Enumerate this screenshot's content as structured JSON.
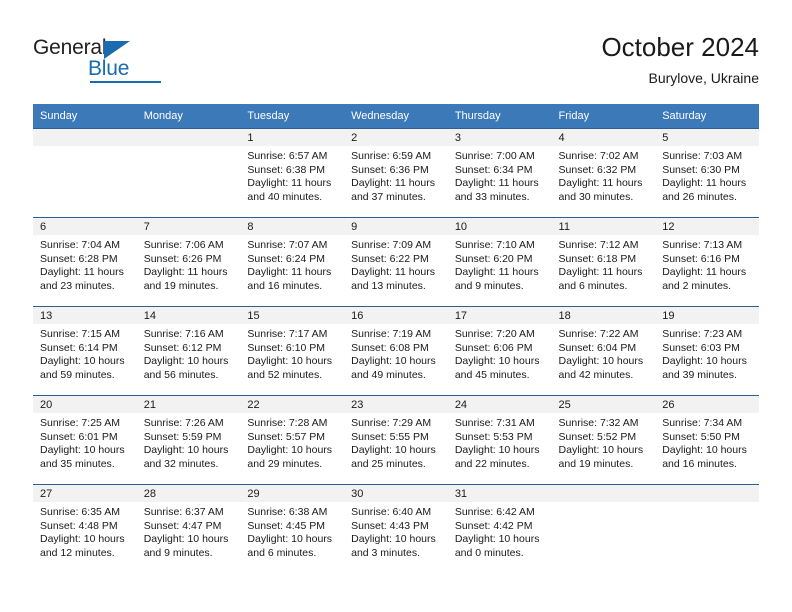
{
  "brand": {
    "word1": "General",
    "word2": "Blue",
    "triangle_color": "#1a6cb0"
  },
  "header": {
    "title": "October 2024",
    "subtitle": "Burylove, Ukraine",
    "accent_color": "#3b79b8",
    "grid_line_color": "#2e5f94",
    "daynum_strip_color": "#f2f2f2"
  },
  "weekday_headers": [
    "Sunday",
    "Monday",
    "Tuesday",
    "Wednesday",
    "Thursday",
    "Friday",
    "Saturday"
  ],
  "weeks": [
    [
      {
        "day": "",
        "lines": []
      },
      {
        "day": "",
        "lines": []
      },
      {
        "day": "1",
        "lines": [
          "Sunrise: 6:57 AM",
          "Sunset: 6:38 PM",
          "Daylight: 11 hours",
          "and 40 minutes."
        ]
      },
      {
        "day": "2",
        "lines": [
          "Sunrise: 6:59 AM",
          "Sunset: 6:36 PM",
          "Daylight: 11 hours",
          "and 37 minutes."
        ]
      },
      {
        "day": "3",
        "lines": [
          "Sunrise: 7:00 AM",
          "Sunset: 6:34 PM",
          "Daylight: 11 hours",
          "and 33 minutes."
        ]
      },
      {
        "day": "4",
        "lines": [
          "Sunrise: 7:02 AM",
          "Sunset: 6:32 PM",
          "Daylight: 11 hours",
          "and 30 minutes."
        ]
      },
      {
        "day": "5",
        "lines": [
          "Sunrise: 7:03 AM",
          "Sunset: 6:30 PM",
          "Daylight: 11 hours",
          "and 26 minutes."
        ]
      }
    ],
    [
      {
        "day": "6",
        "lines": [
          "Sunrise: 7:04 AM",
          "Sunset: 6:28 PM",
          "Daylight: 11 hours",
          "and 23 minutes."
        ]
      },
      {
        "day": "7",
        "lines": [
          "Sunrise: 7:06 AM",
          "Sunset: 6:26 PM",
          "Daylight: 11 hours",
          "and 19 minutes."
        ]
      },
      {
        "day": "8",
        "lines": [
          "Sunrise: 7:07 AM",
          "Sunset: 6:24 PM",
          "Daylight: 11 hours",
          "and 16 minutes."
        ]
      },
      {
        "day": "9",
        "lines": [
          "Sunrise: 7:09 AM",
          "Sunset: 6:22 PM",
          "Daylight: 11 hours",
          "and 13 minutes."
        ]
      },
      {
        "day": "10",
        "lines": [
          "Sunrise: 7:10 AM",
          "Sunset: 6:20 PM",
          "Daylight: 11 hours",
          "and 9 minutes."
        ]
      },
      {
        "day": "11",
        "lines": [
          "Sunrise: 7:12 AM",
          "Sunset: 6:18 PM",
          "Daylight: 11 hours",
          "and 6 minutes."
        ]
      },
      {
        "day": "12",
        "lines": [
          "Sunrise: 7:13 AM",
          "Sunset: 6:16 PM",
          "Daylight: 11 hours",
          "and 2 minutes."
        ]
      }
    ],
    [
      {
        "day": "13",
        "lines": [
          "Sunrise: 7:15 AM",
          "Sunset: 6:14 PM",
          "Daylight: 10 hours",
          "and 59 minutes."
        ]
      },
      {
        "day": "14",
        "lines": [
          "Sunrise: 7:16 AM",
          "Sunset: 6:12 PM",
          "Daylight: 10 hours",
          "and 56 minutes."
        ]
      },
      {
        "day": "15",
        "lines": [
          "Sunrise: 7:17 AM",
          "Sunset: 6:10 PM",
          "Daylight: 10 hours",
          "and 52 minutes."
        ]
      },
      {
        "day": "16",
        "lines": [
          "Sunrise: 7:19 AM",
          "Sunset: 6:08 PM",
          "Daylight: 10 hours",
          "and 49 minutes."
        ]
      },
      {
        "day": "17",
        "lines": [
          "Sunrise: 7:20 AM",
          "Sunset: 6:06 PM",
          "Daylight: 10 hours",
          "and 45 minutes."
        ]
      },
      {
        "day": "18",
        "lines": [
          "Sunrise: 7:22 AM",
          "Sunset: 6:04 PM",
          "Daylight: 10 hours",
          "and 42 minutes."
        ]
      },
      {
        "day": "19",
        "lines": [
          "Sunrise: 7:23 AM",
          "Sunset: 6:03 PM",
          "Daylight: 10 hours",
          "and 39 minutes."
        ]
      }
    ],
    [
      {
        "day": "20",
        "lines": [
          "Sunrise: 7:25 AM",
          "Sunset: 6:01 PM",
          "Daylight: 10 hours",
          "and 35 minutes."
        ]
      },
      {
        "day": "21",
        "lines": [
          "Sunrise: 7:26 AM",
          "Sunset: 5:59 PM",
          "Daylight: 10 hours",
          "and 32 minutes."
        ]
      },
      {
        "day": "22",
        "lines": [
          "Sunrise: 7:28 AM",
          "Sunset: 5:57 PM",
          "Daylight: 10 hours",
          "and 29 minutes."
        ]
      },
      {
        "day": "23",
        "lines": [
          "Sunrise: 7:29 AM",
          "Sunset: 5:55 PM",
          "Daylight: 10 hours",
          "and 25 minutes."
        ]
      },
      {
        "day": "24",
        "lines": [
          "Sunrise: 7:31 AM",
          "Sunset: 5:53 PM",
          "Daylight: 10 hours",
          "and 22 minutes."
        ]
      },
      {
        "day": "25",
        "lines": [
          "Sunrise: 7:32 AM",
          "Sunset: 5:52 PM",
          "Daylight: 10 hours",
          "and 19 minutes."
        ]
      },
      {
        "day": "26",
        "lines": [
          "Sunrise: 7:34 AM",
          "Sunset: 5:50 PM",
          "Daylight: 10 hours",
          "and 16 minutes."
        ]
      }
    ],
    [
      {
        "day": "27",
        "lines": [
          "Sunrise: 6:35 AM",
          "Sunset: 4:48 PM",
          "Daylight: 10 hours",
          "and 12 minutes."
        ]
      },
      {
        "day": "28",
        "lines": [
          "Sunrise: 6:37 AM",
          "Sunset: 4:47 PM",
          "Daylight: 10 hours",
          "and 9 minutes."
        ]
      },
      {
        "day": "29",
        "lines": [
          "Sunrise: 6:38 AM",
          "Sunset: 4:45 PM",
          "Daylight: 10 hours",
          "and 6 minutes."
        ]
      },
      {
        "day": "30",
        "lines": [
          "Sunrise: 6:40 AM",
          "Sunset: 4:43 PM",
          "Daylight: 10 hours",
          "and 3 minutes."
        ]
      },
      {
        "day": "31",
        "lines": [
          "Sunrise: 6:42 AM",
          "Sunset: 4:42 PM",
          "Daylight: 10 hours",
          "and 0 minutes."
        ]
      },
      {
        "day": "",
        "lines": []
      },
      {
        "day": "",
        "lines": []
      }
    ]
  ]
}
